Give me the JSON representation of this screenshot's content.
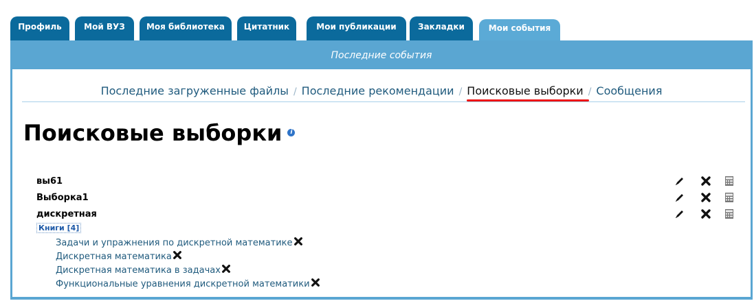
{
  "tabs": [
    {
      "label": "Профиль"
    },
    {
      "label": "Мой ВУЗ"
    },
    {
      "label": "Моя библиотека"
    },
    {
      "label": "Цитатник"
    },
    {
      "label": "Мои публикации"
    },
    {
      "label": "Закладки"
    },
    {
      "label": "Мои события",
      "active": true
    }
  ],
  "subbar_title": "Последние события",
  "subnav": {
    "items": [
      "Последние загруженные файлы",
      "Последние рекомендации",
      "Поисковые выборки",
      "Сообщения"
    ],
    "separator": "/",
    "current": "Поисковые выборки"
  },
  "page_title": "Поисковые выборки",
  "info_icon": "i",
  "selections": [
    {
      "name": "вы61"
    },
    {
      "name": "Выборка1"
    },
    {
      "name": "дискретная"
    }
  ],
  "books_link": "Книги [4]",
  "books": [
    "Задачи и упражнения по дискретной математике",
    "Дискретная математика",
    "Дискретная математика в задачах",
    "Функциональные уравнения дискретной математики"
  ],
  "icons": {
    "edit": "pencil-icon",
    "delete": "cross-icon",
    "save": "calculator-icon"
  },
  "colors": {
    "tab": "#0b6a9c",
    "tab_active": "#5baad6",
    "frame": "#5aa6d2",
    "link": "#1f5a7d",
    "underline": "#e11"
  }
}
